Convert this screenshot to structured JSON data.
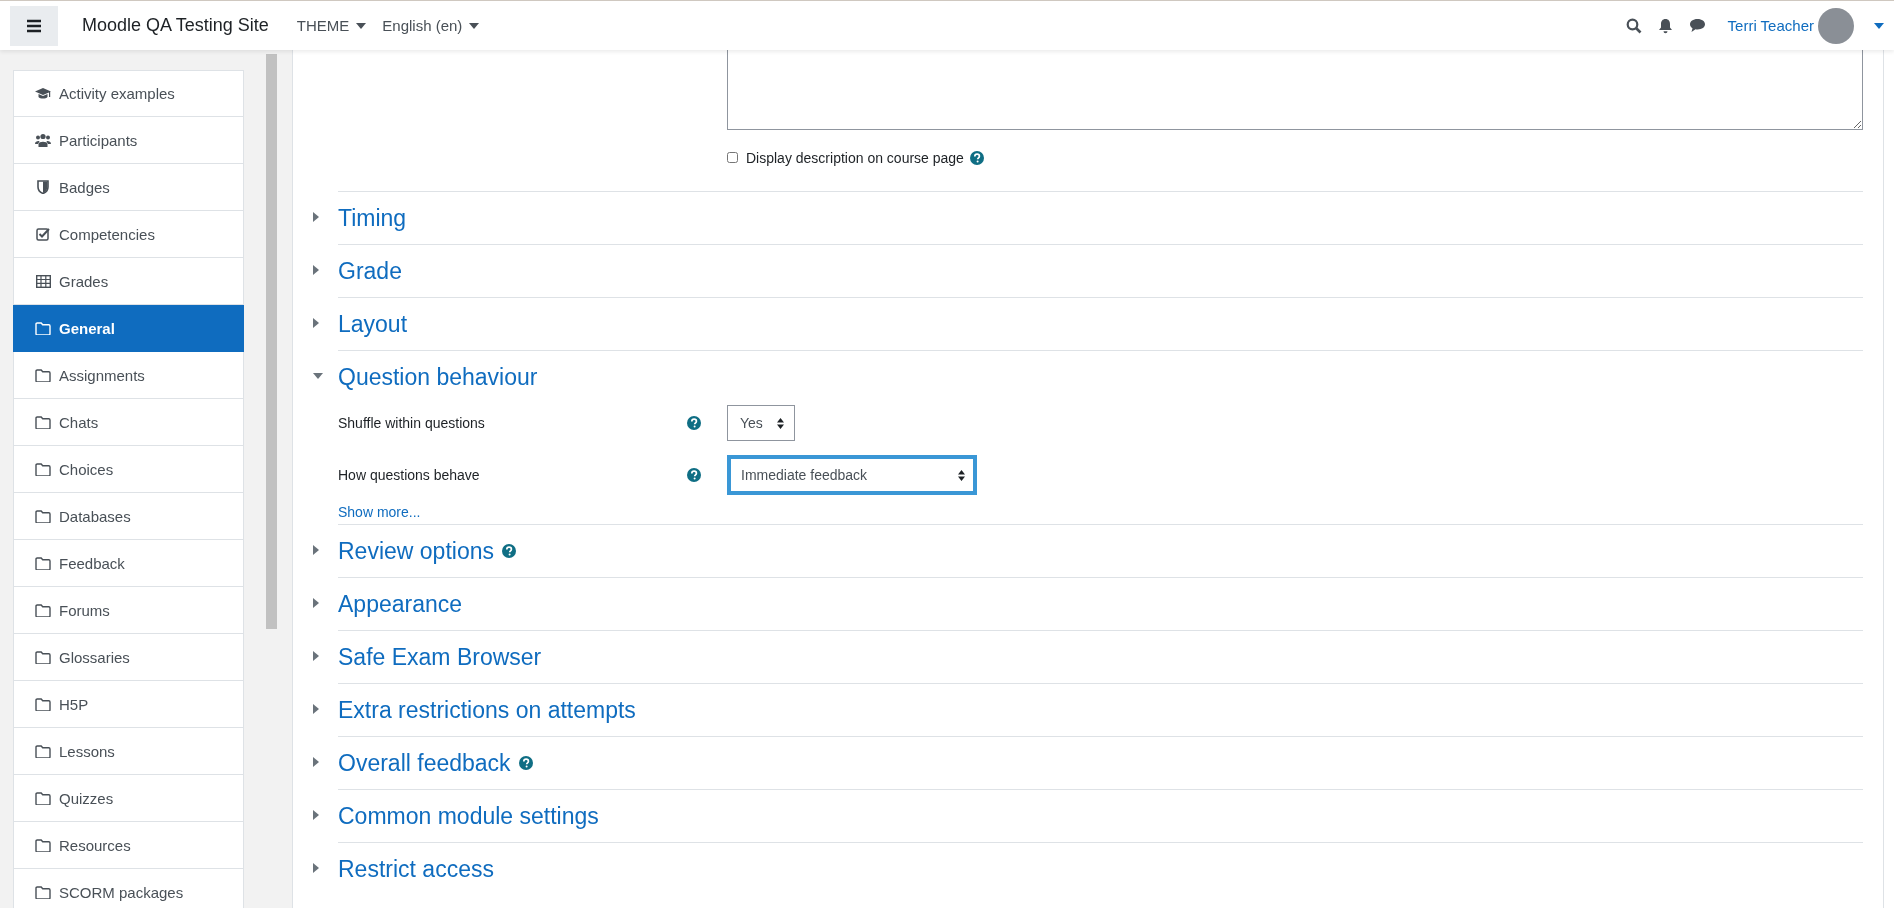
{
  "navbar": {
    "site_name": "Moodle QA Testing Site",
    "menus": [
      {
        "label": "THEME"
      },
      {
        "label": "English (en)"
      }
    ],
    "user_name": "Terri Teacher"
  },
  "sidebar": {
    "items": [
      {
        "label": "Activity examples",
        "kind": "cap",
        "selected": false
      },
      {
        "label": "Participants",
        "kind": "users",
        "selected": false
      },
      {
        "label": "Badges",
        "kind": "shield",
        "selected": false
      },
      {
        "label": "Competencies",
        "kind": "check",
        "selected": false
      },
      {
        "label": "Grades",
        "kind": "table",
        "selected": false
      },
      {
        "label": "General",
        "kind": "folder",
        "selected": true
      },
      {
        "label": "Assignments",
        "kind": "folder",
        "selected": false
      },
      {
        "label": "Chats",
        "kind": "folder",
        "selected": false
      },
      {
        "label": "Choices",
        "kind": "folder",
        "selected": false
      },
      {
        "label": "Databases",
        "kind": "folder",
        "selected": false
      },
      {
        "label": "Feedback",
        "kind": "folder",
        "selected": false
      },
      {
        "label": "Forums",
        "kind": "folder",
        "selected": false
      },
      {
        "label": "Glossaries",
        "kind": "folder",
        "selected": false
      },
      {
        "label": "H5P",
        "kind": "folder",
        "selected": false
      },
      {
        "label": "Lessons",
        "kind": "folder",
        "selected": false
      },
      {
        "label": "Quizzes",
        "kind": "folder",
        "selected": false
      },
      {
        "label": "Resources",
        "kind": "folder",
        "selected": false
      },
      {
        "label": "SCORM packages",
        "kind": "folder",
        "selected": false
      }
    ]
  },
  "form": {
    "description_checkbox": {
      "label": "Display description on course page",
      "checked": false
    },
    "sections": [
      {
        "title": "Timing",
        "expanded": false,
        "help": false
      },
      {
        "title": "Grade",
        "expanded": false,
        "help": false
      },
      {
        "title": "Layout",
        "expanded": false,
        "help": false
      },
      {
        "title": "Question behaviour",
        "expanded": true,
        "help": false,
        "fields": [
          {
            "label": "Shuffle within questions",
            "value": "Yes",
            "focused": false
          },
          {
            "label": "How questions behave",
            "value": "Immediate feedback",
            "focused": true
          }
        ],
        "show_more": "Show more..."
      },
      {
        "title": "Review options",
        "expanded": false,
        "help": true
      },
      {
        "title": "Appearance",
        "expanded": false,
        "help": false
      },
      {
        "title": "Safe Exam Browser",
        "expanded": false,
        "help": false
      },
      {
        "title": "Extra restrictions on attempts",
        "expanded": false,
        "help": false
      },
      {
        "title": "Overall feedback",
        "expanded": false,
        "help": true
      },
      {
        "title": "Common module settings",
        "expanded": false,
        "help": false
      },
      {
        "title": "Restrict access",
        "expanded": false,
        "help": false
      }
    ]
  }
}
